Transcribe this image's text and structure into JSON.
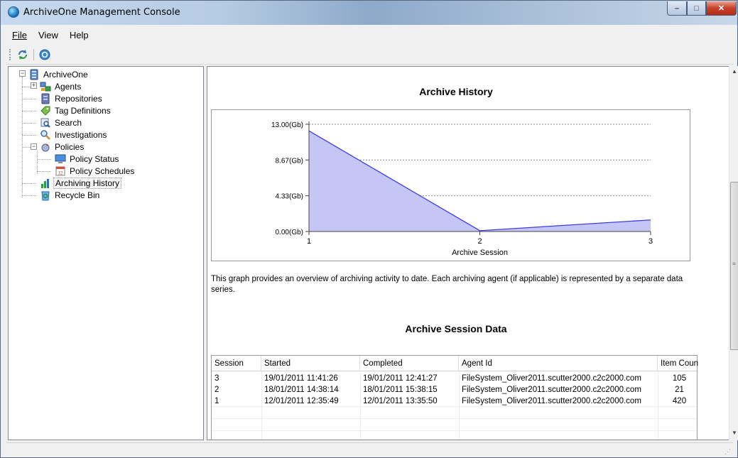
{
  "window": {
    "title": "ArchiveOne Management Console",
    "controls": {
      "minimize": "–",
      "maximize": "□",
      "close": "✕"
    }
  },
  "menu": {
    "items": [
      {
        "label": "File",
        "underline": "F"
      },
      {
        "label": "View"
      },
      {
        "label": "Help"
      }
    ]
  },
  "toolbar": {
    "buttons": [
      {
        "icon": "refresh-icon"
      },
      {
        "icon": "help-icon"
      }
    ]
  },
  "tree": {
    "root": "ArchiveOne",
    "items": [
      {
        "label": "Agents",
        "icon": "agents-icon",
        "expandable": true
      },
      {
        "label": "Repositories",
        "icon": "repository-icon"
      },
      {
        "label": "Tag Definitions",
        "icon": "tag-icon"
      },
      {
        "label": "Search",
        "icon": "search-icon"
      },
      {
        "label": "Investigations",
        "icon": "investigation-icon"
      },
      {
        "label": "Policies",
        "icon": "policies-icon",
        "expandable": true,
        "expanded": true
      },
      {
        "label": "Policy Status",
        "icon": "policy-status-icon"
      },
      {
        "label": "Policy Schedules",
        "icon": "calendar-icon"
      },
      {
        "label": "Archiving History",
        "icon": "chart-icon",
        "selected": true
      },
      {
        "label": "Recycle Bin",
        "icon": "recycle-bin-icon"
      }
    ]
  },
  "history": {
    "title": "Archive History",
    "description": "This graph provides an overview of archiving activity to date. Each archiving agent (if applicable) is represented by a separate data series.",
    "table_title": "Archive Session Data"
  },
  "chart_data": {
    "type": "area",
    "title": "Archive History",
    "xlabel": "Archive Session",
    "ylabel": "",
    "x": [
      1,
      2,
      3
    ],
    "series": [
      {
        "values": [
          12.2,
          0.1,
          1.4
        ]
      }
    ],
    "ylim": [
      0,
      13
    ],
    "yticks": [
      "0.00(Gb)",
      "4.33(Gb)",
      "8.67(Gb)",
      "13.00(Gb)"
    ],
    "ytick_values": [
      0,
      4.33,
      8.67,
      13
    ],
    "xticks": [
      "1",
      "2",
      "3"
    ],
    "colors": {
      "fill": "#c6c6f6",
      "line": "#3d3de6"
    },
    "grid": true
  },
  "table": {
    "columns": [
      "Session",
      "Started",
      "Completed",
      "Agent Id",
      "Item Count"
    ],
    "rows": [
      [
        "3",
        "19/01/2011 11:41:26",
        "19/01/2011 12:41:27",
        "FileSystem_Oliver2011.scutter2000.c2c2000.com",
        "105"
      ],
      [
        "2",
        "18/01/2011 14:38:14",
        "18/01/2011 15:38:15",
        "FileSystem_Oliver2011.scutter2000.c2c2000.com",
        "21"
      ],
      [
        "1",
        "12/01/2011 12:35:49",
        "12/01/2011 13:35:50",
        "FileSystem_Oliver2011.scutter2000.c2c2000.com",
        "420"
      ]
    ]
  }
}
